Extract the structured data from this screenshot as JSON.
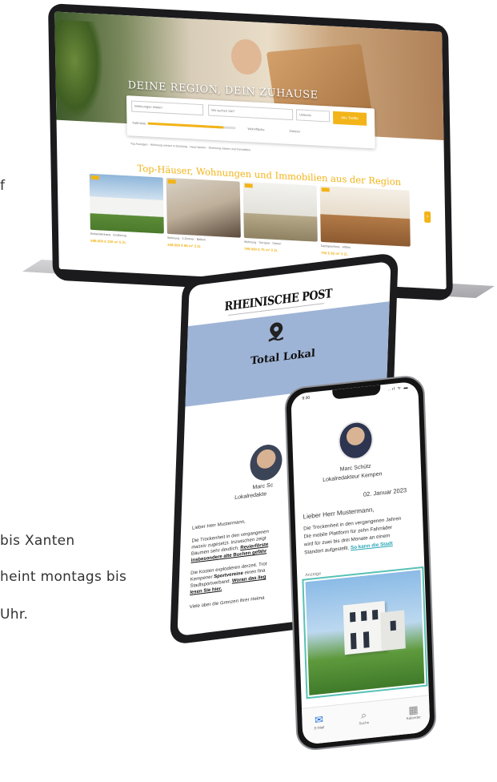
{
  "page_edge": {
    "line0": "f",
    "line1": "bis Xanten",
    "line2": "heint montags bis",
    "line3": "Uhr."
  },
  "laptop": {
    "hero_title": "DEINE REGION, DEIN ZUHAUSE",
    "search": {
      "type_value": "Wohnungen mieten",
      "location_placeholder": "Wo suchen Sie?",
      "radius_value": "Umkreis",
      "button": "Alle Treffer",
      "price_label": "Kaltmiete",
      "area_label": "Wohnfläche",
      "rooms_label": "Zimmer"
    },
    "links": "Top Anzeigen · Wohnung mieten in Duisburg · Haus kaufen · Wohnung mieten und Immobilien",
    "heading": "Top-Häuser, Wohnungen und Immobilien aus der Region",
    "cards": [
      {
        "caption": "Einfamilienhaus · Erstbezug",
        "price": "599.000 €  150 m²  5 Zi."
      },
      {
        "caption": "Wohnung · 3 Zimmer · Balkon",
        "price": "349.000 €  96 m²  3 Zi."
      },
      {
        "caption": "Wohnung · Terrasse · Garten",
        "price": "799.000 €  75 m²  3 Zi."
      },
      {
        "caption": "Dachgeschoss · Altbau",
        "price": "750 €  82 m²  3 Zi."
      }
    ],
    "next_glyph": "›"
  },
  "tablet": {
    "logo": "RHEINISCHE POST",
    "title": "Total Lokal",
    "author_name": "Marc Sc",
    "author_role": "Lokalredakte",
    "greeting": "Lieber Herr Mustermann,",
    "p1_l1": "Die Trockenheit in den vergangenen",
    "p1_l2": "massiv zugesetzt. Inzwischen zeigt",
    "p1_l3": "Bäumen sehr deutlich.",
    "p1_link1": "Revierförste",
    "p1_link2": "insbesondere alte Buchen gefähr",
    "p2_l1": "Die Kosten explodieren derzeit. Trot",
    "p2_l2": "Kempener",
    "p2_bold": "Sportvereine",
    "p2_l2b": "einen fina",
    "p2_l3": "Stadtsportverband.",
    "p2_link": "Woran das lieg",
    "p2_link2": "lesen Sie hier.",
    "p3_l1": "Viele über die Grenzen ihrer Heima"
  },
  "phone": {
    "time": "9:30",
    "signal": "..ıl ᯤ ▬",
    "author_name": "Marc Schütz",
    "author_role": "Lokalredakteur Kempen",
    "date": "02. Januar 2023",
    "greeting": "Lieber Herr Mustermann,",
    "p_l1": "Die Trockenheit in den vergangenen Jahren",
    "p_l2": "Die mobile Plattform für zehn Fahrräder",
    "p_l3": "wird für zwei bis drei Monate an einem",
    "p_l4": "Standort aufgestellt.",
    "p_link": "So kann die Stadt",
    "ad_label": "Anzeige",
    "reply": "Allen antworten",
    "tabs": [
      {
        "glyph": "✉",
        "label": "E-Mail"
      },
      {
        "glyph": "⌕",
        "label": "Suche"
      },
      {
        "glyph": "▦",
        "label": "Kalender"
      }
    ]
  }
}
